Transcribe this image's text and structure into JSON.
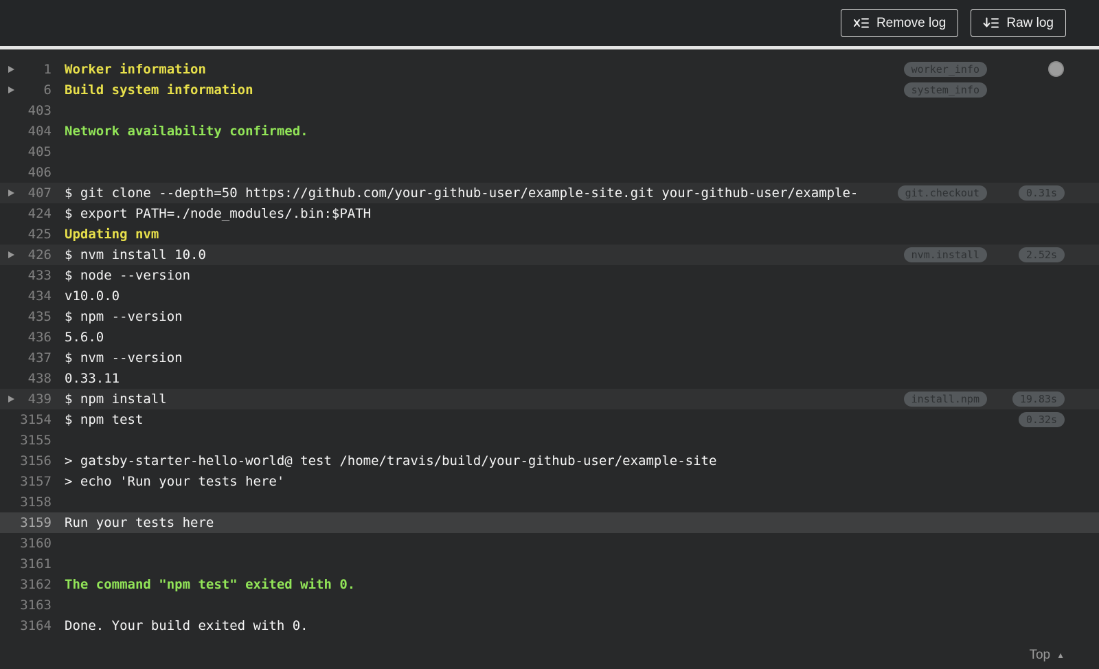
{
  "toolbar": {
    "remove_log_label": "Remove log",
    "raw_log_label": "Raw log"
  },
  "icons": {
    "remove_log": "clear-log-list-icon",
    "raw_log": "download-log-list-icon",
    "fold": "fold-toggle-triangle-icon",
    "top": "chevron-up-icon"
  },
  "colors": {
    "toolbar_bg": "#242628",
    "log_bg": "#28292a",
    "row_soft": "#313233",
    "row_strong": "#3e3f40",
    "text": "#f5f5f5",
    "line_number": "#808080",
    "accent_yellow": "#e8e04b",
    "accent_green": "#92e558",
    "pill_bg": "#54585b",
    "pill_text": "#2e3133"
  },
  "log": {
    "lines": [
      {
        "number": 1,
        "text": "Worker information",
        "style": "yellow",
        "fold": true,
        "tag": "worker_info"
      },
      {
        "number": 6,
        "text": "Build system information",
        "style": "yellow",
        "fold": true,
        "tag": "system_info"
      },
      {
        "number": 403,
        "text": ""
      },
      {
        "number": 404,
        "text": "Network availability confirmed.",
        "style": "green"
      },
      {
        "number": 405,
        "text": ""
      },
      {
        "number": 406,
        "text": ""
      },
      {
        "number": 407,
        "text": "$ git clone --depth=50 https://github.com/your-github-user/example-site.git your-github-user/example-",
        "fold": true,
        "tag": "git.checkout",
        "duration": "0.31s",
        "highlight": "soft"
      },
      {
        "number": 424,
        "text": "$ export PATH=./node_modules/.bin:$PATH"
      },
      {
        "number": 425,
        "text": "Updating nvm",
        "style": "yellow"
      },
      {
        "number": 426,
        "text": "$ nvm install 10.0",
        "fold": true,
        "tag": "nvm.install",
        "duration": "2.52s",
        "highlight": "soft"
      },
      {
        "number": 433,
        "text": "$ node --version"
      },
      {
        "number": 434,
        "text": "v10.0.0"
      },
      {
        "number": 435,
        "text": "$ npm --version"
      },
      {
        "number": 436,
        "text": "5.6.0"
      },
      {
        "number": 437,
        "text": "$ nvm --version"
      },
      {
        "number": 438,
        "text": "0.33.11"
      },
      {
        "number": 439,
        "text": "$ npm install",
        "fold": true,
        "tag": "install.npm",
        "duration": "19.83s",
        "highlight": "soft"
      },
      {
        "number": 3154,
        "text": "$ npm test",
        "duration": "0.32s"
      },
      {
        "number": 3155,
        "text": ""
      },
      {
        "number": 3156,
        "text": "> gatsby-starter-hello-world@ test /home/travis/build/your-github-user/example-site"
      },
      {
        "number": 3157,
        "text": "> echo 'Run your tests here'"
      },
      {
        "number": 3158,
        "text": ""
      },
      {
        "number": 3159,
        "text": "Run your tests here",
        "highlight": "strong"
      },
      {
        "number": 3160,
        "text": ""
      },
      {
        "number": 3161,
        "text": ""
      },
      {
        "number": 3162,
        "text": "The command \"npm test\" exited with 0.",
        "style": "green"
      },
      {
        "number": 3163,
        "text": ""
      },
      {
        "number": 3164,
        "text": "Done. Your build exited with 0."
      }
    ]
  },
  "footer": {
    "top_label": "Top"
  }
}
